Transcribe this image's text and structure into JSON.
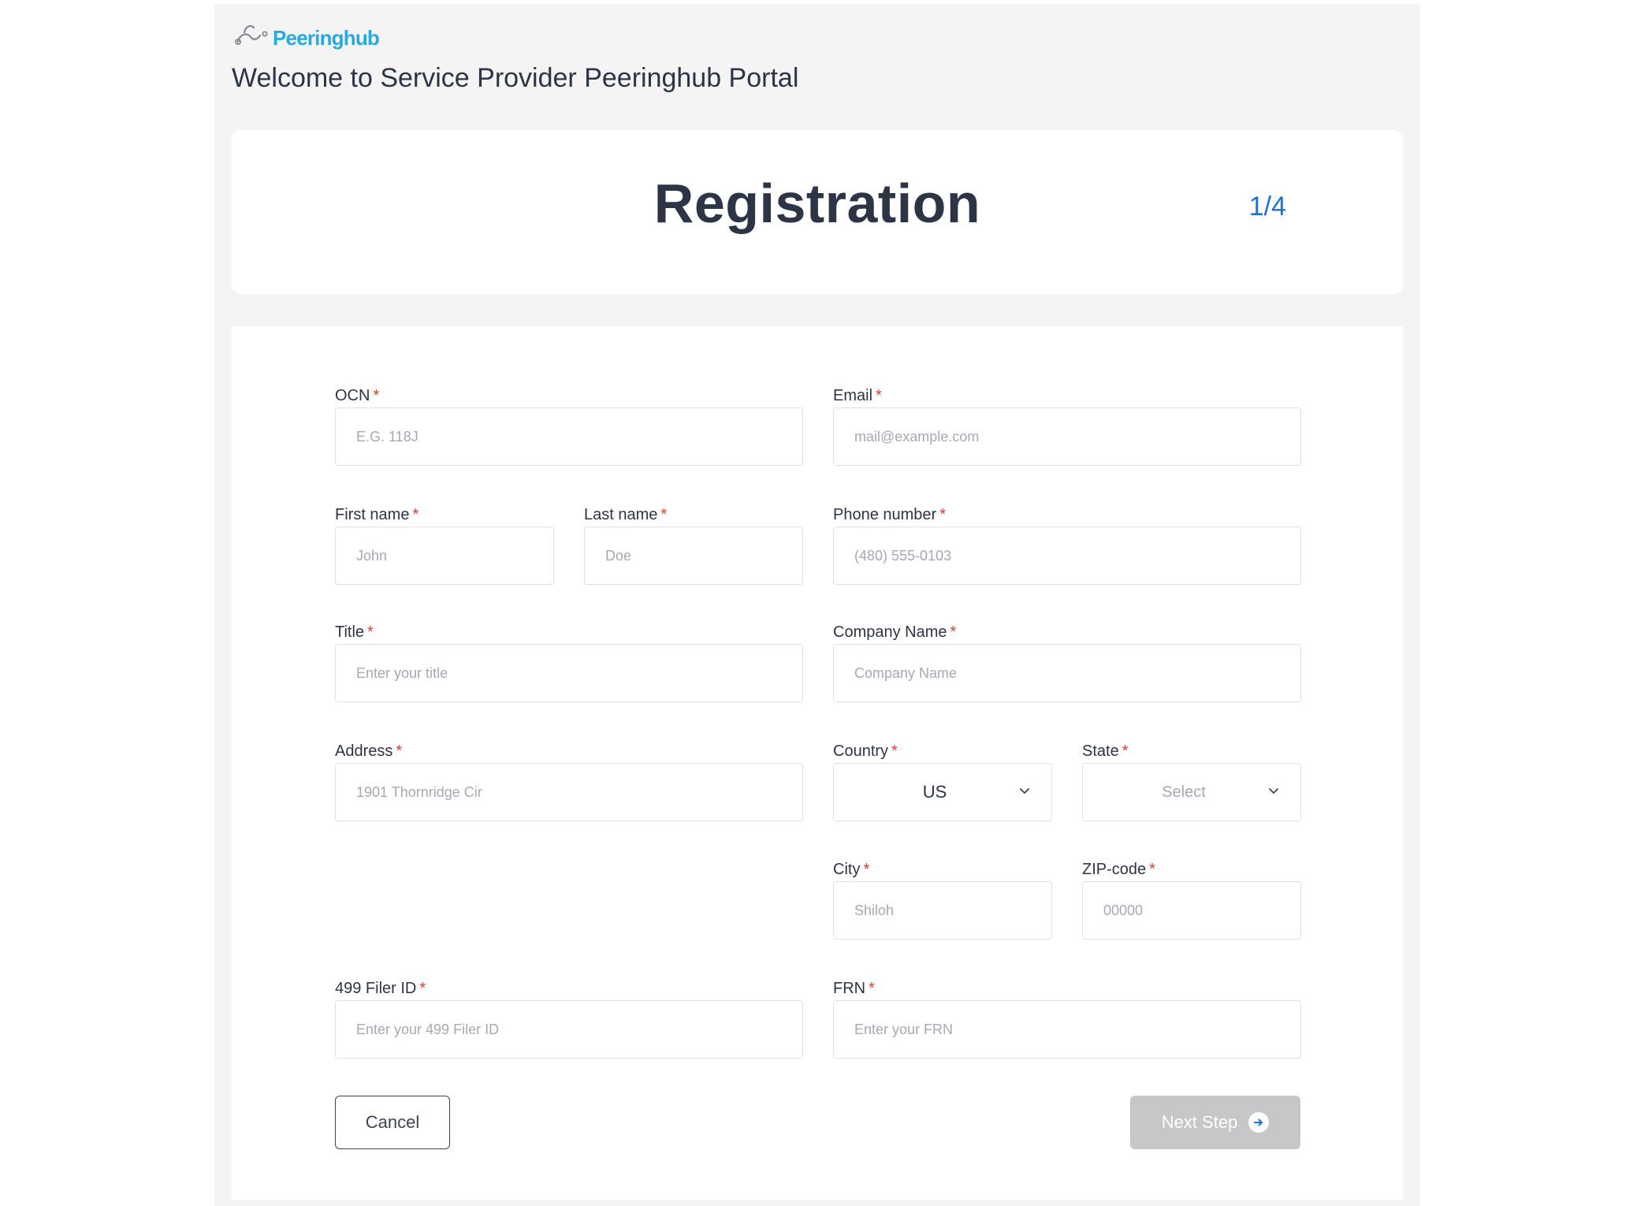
{
  "brand": {
    "name": "Peeringhub"
  },
  "header": {
    "welcome": "Welcome to Service Provider Peeringhub Portal"
  },
  "registration": {
    "title": "Registration",
    "step": "1/4"
  },
  "form": {
    "required_mark": "*",
    "ocn": {
      "label": "OCN",
      "placeholder": "E.G. 118J"
    },
    "email": {
      "label": "Email",
      "placeholder": "mail@example.com"
    },
    "first_name": {
      "label": "First name",
      "placeholder": "John"
    },
    "last_name": {
      "label": "Last name",
      "placeholder": "Doe"
    },
    "phone": {
      "label": "Phone number",
      "placeholder": "(480) 555-0103"
    },
    "title": {
      "label": "Title",
      "placeholder": "Enter your title"
    },
    "company": {
      "label": "Company Name",
      "placeholder": "Company Name"
    },
    "address": {
      "label": "Address",
      "placeholder": "1901 Thornridge Cir"
    },
    "country": {
      "label": "Country",
      "value": "US"
    },
    "state": {
      "label": "State",
      "placeholder": "Select"
    },
    "city": {
      "label": "City",
      "placeholder": "Shiloh"
    },
    "zip": {
      "label": "ZIP-code",
      "placeholder": "00000"
    },
    "filer_id": {
      "label": "499 Filer ID",
      "placeholder": "Enter your 499 Filer ID"
    },
    "frn": {
      "label": "FRN",
      "placeholder": "Enter your FRN"
    }
  },
  "actions": {
    "cancel": "Cancel",
    "next": "Next Step"
  },
  "colors": {
    "accent": "#1e6fd9",
    "brand": "#27a8df",
    "required": "#e53935",
    "disabled_button": "#c6c7c9"
  },
  "icons": {
    "chevron": "chevron-down-icon",
    "next": "arrow-right-circle-icon",
    "logo": "peeringhub-logo-icon"
  }
}
